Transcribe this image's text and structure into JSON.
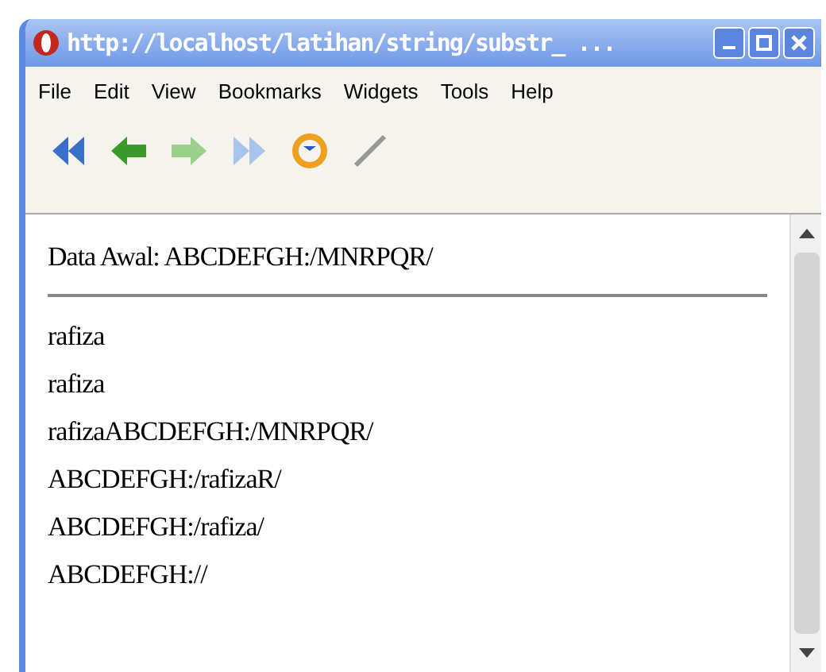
{
  "window": {
    "title": "http://localhost/latihan/string/substr_ ..."
  },
  "menu": [
    "File",
    "Edit",
    "View",
    "Bookmarks",
    "Widgets",
    "Tools",
    "Help"
  ],
  "content": {
    "heading": "Data Awal: ABCDEFGH:/MNRPQR/",
    "lines": [
      "rafiza",
      "rafiza",
      "rafizaABCDEFGH:/MNRPQR/",
      "ABCDEFGH:/rafizaR/",
      "ABCDEFGH:/rafiza/",
      "ABCDEFGH://"
    ]
  }
}
